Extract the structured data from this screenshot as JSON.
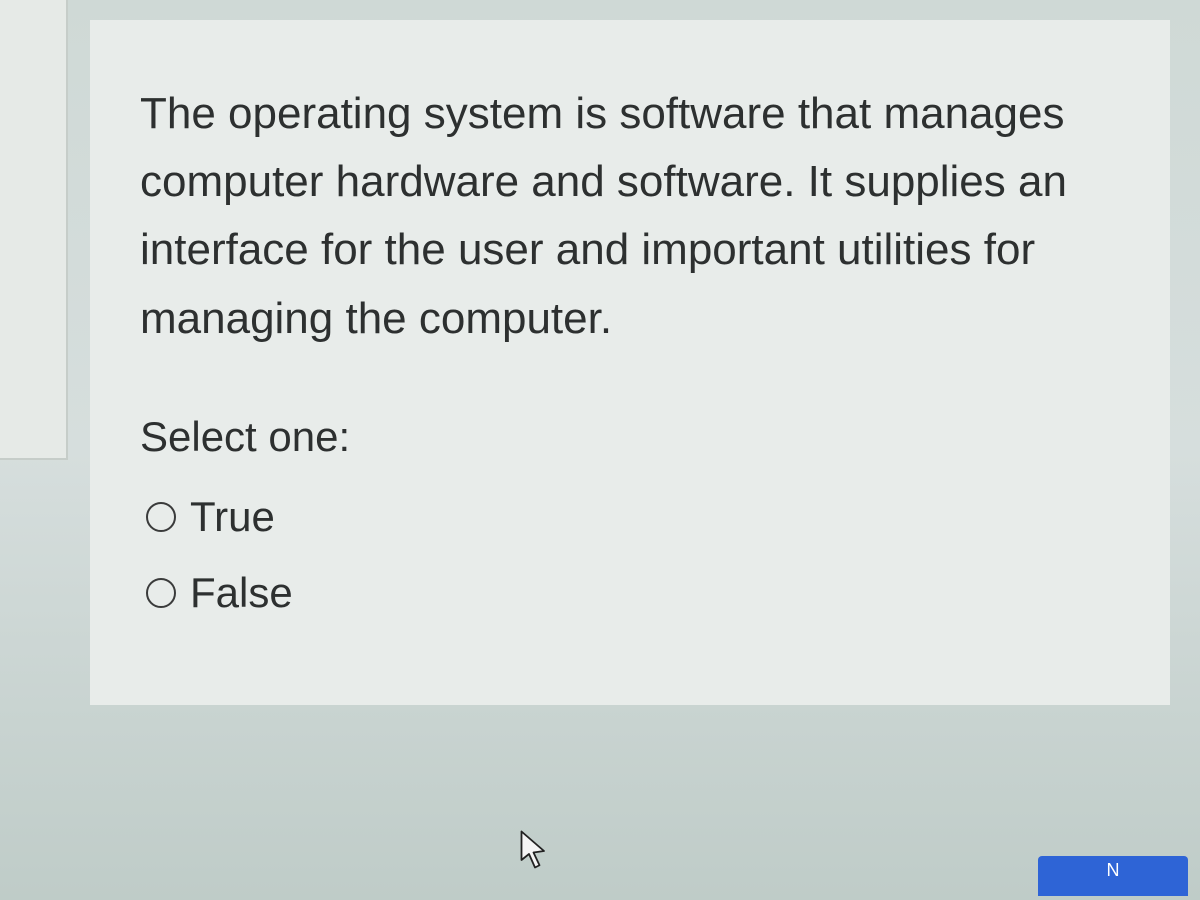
{
  "question": {
    "text": "The operating system is software that manages computer hardware and software. It supplies an interface for the user and important utilities for managing the computer.",
    "prompt": "Select one:",
    "options": [
      {
        "label": "True"
      },
      {
        "label": "False"
      }
    ]
  },
  "nav": {
    "next_label": "N"
  }
}
